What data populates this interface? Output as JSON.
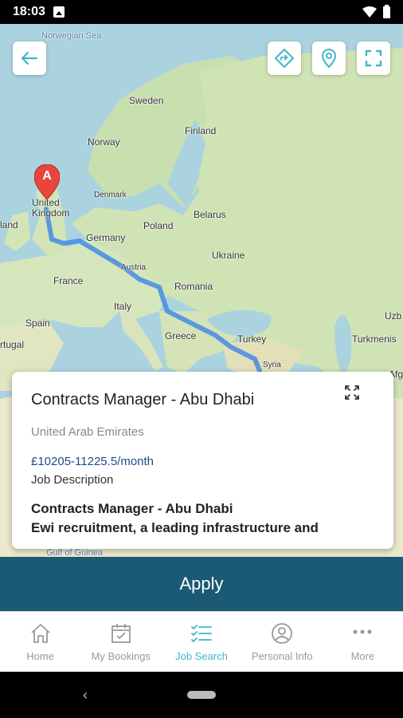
{
  "status": {
    "time": "18:03"
  },
  "map": {
    "labels": {
      "norwegian_sea": "Norwegian Sea",
      "sweden": "Sweden",
      "norway": "Norway",
      "finland": "Finland",
      "denmark": "Denmark",
      "united_kingdom": "United Kingdom",
      "ireland": "land",
      "belarus": "Belarus",
      "poland": "Poland",
      "germany": "Germany",
      "ukraine": "Ukraine",
      "france": "France",
      "austria": "Austria",
      "romania": "Romania",
      "italy": "Italy",
      "spain": "Spain",
      "portugal": "rtugal",
      "greece": "Greece",
      "turkey": "Turkey",
      "syria": "Syria",
      "uzbekistan": "Uzb",
      "turkmenistan": "Turkmenis",
      "afghanistan": "Afg",
      "gulf_of_guinea": "Gulf of Guinea",
      "marker": "A"
    },
    "buttons": {
      "back": "back-arrow-icon",
      "directions": "directions-icon",
      "location": "location-pin-icon",
      "fullscreen": "fullscreen-icon"
    }
  },
  "job": {
    "title": "Contracts Manager - Abu Dhabi",
    "location": "United Arab Emirates",
    "salary": "£10205-11225.5/month",
    "description_label": "Job Description",
    "description_title": "Contracts Manager - Abu Dhabi",
    "description_text": "Ewi recruitment, a leading infrastructure and"
  },
  "apply": {
    "label": "Apply"
  },
  "nav": {
    "items": [
      {
        "label": "Home",
        "icon": "home-icon"
      },
      {
        "label": "My Bookings",
        "icon": "calendar-icon"
      },
      {
        "label": "Job Search",
        "icon": "checklist-icon"
      },
      {
        "label": "Personal Info",
        "icon": "user-icon"
      },
      {
        "label": "More",
        "icon": "more-icon"
      }
    ],
    "active": "Job Search"
  },
  "colors": {
    "accent": "#3fb6c8",
    "apply_bar": "#1a5a75",
    "route": "#4a90e2",
    "salary": "#1e4b8a"
  }
}
